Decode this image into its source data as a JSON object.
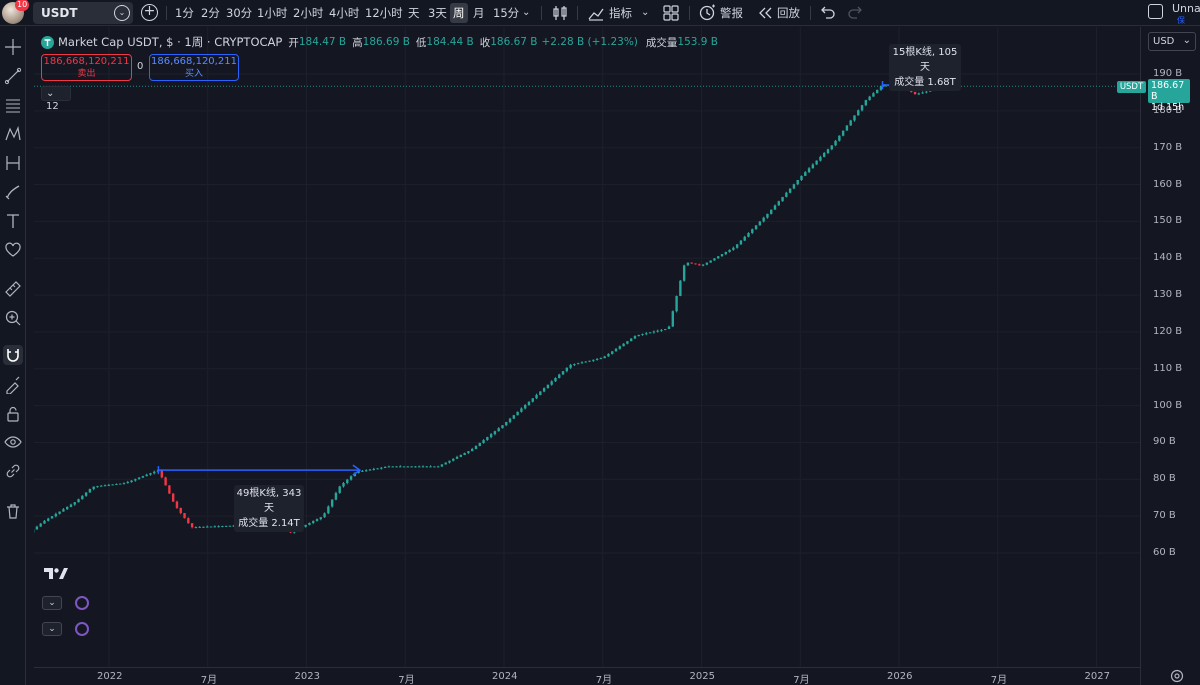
{
  "user": {
    "notifications": "10",
    "name": "Unna",
    "sub": "保"
  },
  "symbol": "USDT",
  "intervals": [
    {
      "label": "1分",
      "active": false
    },
    {
      "label": "2分",
      "active": false
    },
    {
      "label": "30分",
      "active": false
    },
    {
      "label": "1小时",
      "active": false
    },
    {
      "label": "2小时",
      "active": false
    },
    {
      "label": "4小时",
      "active": false
    },
    {
      "label": "12小时",
      "active": false
    },
    {
      "label": "天",
      "active": false
    },
    {
      "label": "3天",
      "active": false
    },
    {
      "label": "周",
      "active": true
    },
    {
      "label": "月",
      "active": false
    },
    {
      "label": "15分",
      "active": false
    }
  ],
  "toolbar": {
    "indicators": "指标",
    "alert": "警报",
    "replay": "回放"
  },
  "legend": {
    "title": "Market Cap USDT, $ · 1周 · CRYPTOCAP",
    "open_label": "开",
    "open": "184.47 B",
    "high_label": "高",
    "high": "186.69 B",
    "low_label": "低",
    "low": "184.44 B",
    "close_label": "收",
    "close": "186.67 B",
    "change": "+2.28 B (+1.23%)",
    "volume_label": "成交量",
    "volume": "153.9 B",
    "collapse": "12"
  },
  "sell": {
    "price": "186,668,120,211",
    "label": "卖出"
  },
  "buy": {
    "price": "186,668,120,211",
    "label": "买入"
  },
  "spread": "0",
  "currency": "USD",
  "price_ticks": [
    "190 B",
    "180 B",
    "170 B",
    "160 B",
    "150 B",
    "140 B",
    "130 B",
    "120 B",
    "110 B",
    "100 B",
    "90 B",
    "80 B",
    "70 B",
    "60 B"
  ],
  "last_price": {
    "symbol": "USDT",
    "value": "186.67 B",
    "countdown": "1d 15h"
  },
  "time_ticks": [
    "2022",
    "7月",
    "2023",
    "7月",
    "2024",
    "7月",
    "2025",
    "7月",
    "2026",
    "7月",
    "2027"
  ],
  "measures": [
    {
      "line1": "49根K线, 343天",
      "line2": "成交量 2.14T"
    },
    {
      "line1": "15根K线, 105天",
      "line2": "成交量 1.68T"
    }
  ],
  "colors": {
    "up": "#26a69a",
    "down": "#f23645",
    "measure": "#2962ff",
    "background": "#141722"
  },
  "chart_data": {
    "type": "candlestick",
    "interval": "1周",
    "unit": "B USD",
    "ylim": [
      60,
      193
    ],
    "x_start": "2021-07",
    "x_end": "2027-02",
    "keypoints": [
      {
        "date": "2021-08",
        "value": 65
      },
      {
        "date": "2021-09",
        "value": 68.5
      },
      {
        "date": "2021-11",
        "value": 74
      },
      {
        "date": "2021-12",
        "value": 78
      },
      {
        "date": "2022-02",
        "value": 79
      },
      {
        "date": "2022-04",
        "value": 82.5
      },
      {
        "date": "2022-05",
        "value": 73
      },
      {
        "date": "2022-06",
        "value": 67
      },
      {
        "date": "2022-09",
        "value": 67.5
      },
      {
        "date": "2022-11",
        "value": 69.5
      },
      {
        "date": "2022-12",
        "value": 65.5
      },
      {
        "date": "2023-02",
        "value": 70
      },
      {
        "date": "2023-03",
        "value": 78
      },
      {
        "date": "2023-04",
        "value": 82
      },
      {
        "date": "2023-06",
        "value": 83.5
      },
      {
        "date": "2023-09",
        "value": 83.5
      },
      {
        "date": "2023-11",
        "value": 88
      },
      {
        "date": "2024-01",
        "value": 95
      },
      {
        "date": "2024-03",
        "value": 103
      },
      {
        "date": "2024-05",
        "value": 111
      },
      {
        "date": "2024-07",
        "value": 113
      },
      {
        "date": "2024-09",
        "value": 119
      },
      {
        "date": "2024-11",
        "value": 121
      },
      {
        "date": "2024-12",
        "value": 139
      },
      {
        "date": "2025-01",
        "value": 138
      },
      {
        "date": "2025-03",
        "value": 143
      },
      {
        "date": "2025-05",
        "value": 152
      },
      {
        "date": "2025-07",
        "value": 162
      },
      {
        "date": "2025-09",
        "value": 171
      },
      {
        "date": "2025-11",
        "value": 183
      },
      {
        "date": "2025-12",
        "value": 187
      },
      {
        "date": "2026-01",
        "value": 187
      },
      {
        "date": "2026-02",
        "value": 184.5
      },
      {
        "date": "2026-04",
        "value": 186.67
      }
    ],
    "measures": [
      {
        "from": "2022-04",
        "to": "2023-04",
        "level": 82.5,
        "bars": 49,
        "days": 343,
        "volume": "2.14T"
      },
      {
        "from": "2025-12",
        "to": "2026-04",
        "level": 187,
        "bars": 15,
        "days": 105,
        "volume": "1.68T"
      }
    ],
    "last_close": 186.67
  }
}
